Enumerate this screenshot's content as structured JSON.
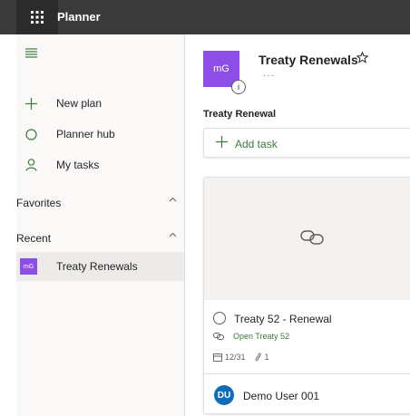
{
  "app": {
    "title": "Planner"
  },
  "sidebar": {
    "items": [
      {
        "label": "New plan",
        "icon": "plus-icon"
      },
      {
        "label": "Planner hub",
        "icon": "circle-icon"
      },
      {
        "label": "My tasks",
        "icon": "person-icon"
      }
    ],
    "favorites_label": "Favorites",
    "recent_label": "Recent",
    "recent_items": [
      {
        "label": "Treaty Renewals",
        "avatar": "mG"
      }
    ]
  },
  "plan": {
    "avatar": "mG",
    "info_badge": "i",
    "title": "Treaty Renewals",
    "more": "···",
    "bucket": "Treaty Renewal",
    "add_task_label": "Add task"
  },
  "task": {
    "title": "Treaty 52 - Renewal",
    "attachment": "Open Treaty 52",
    "due": "12/31",
    "attachments_count": "1",
    "assignee_initials": "DU",
    "assignee_name": "Demo User 001"
  },
  "colors": {
    "topbar": "#3a3a3a",
    "plan_avatar": "#8d4ee8",
    "accent_green": "#3a7a3c",
    "user_avatar": "#0f6cbd"
  }
}
